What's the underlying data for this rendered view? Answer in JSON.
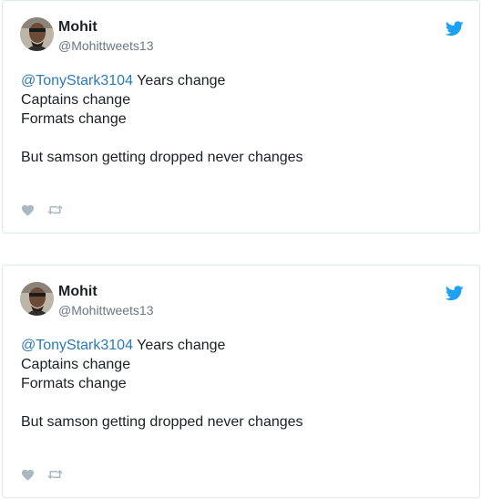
{
  "tweets": [
    {
      "author": {
        "name": "Mohit",
        "handle": "@Mohittweets13"
      },
      "mention": "@TonyStark3104",
      "line1_rest": " Years change",
      "lines": [
        "Captains change",
        "Formats change",
        "",
        "But samson getting dropped never changes"
      ]
    },
    {
      "author": {
        "name": "Mohit",
        "handle": "@Mohittweets13"
      },
      "mention": "@TonyStark3104",
      "line1_rest": " Years change",
      "lines": [
        "Captains change",
        "Formats change",
        "",
        "But samson getting dropped never changes"
      ]
    }
  ],
  "colors": {
    "link": "#2b7bb9",
    "twitter_blue": "#1da1f2",
    "text": "#1c2022",
    "muted": "#697882",
    "action_icon": "#aab8c2"
  },
  "icons": {
    "brand": "twitter-bird-icon",
    "like": "heart-icon",
    "retweet": "retweet-icon"
  }
}
